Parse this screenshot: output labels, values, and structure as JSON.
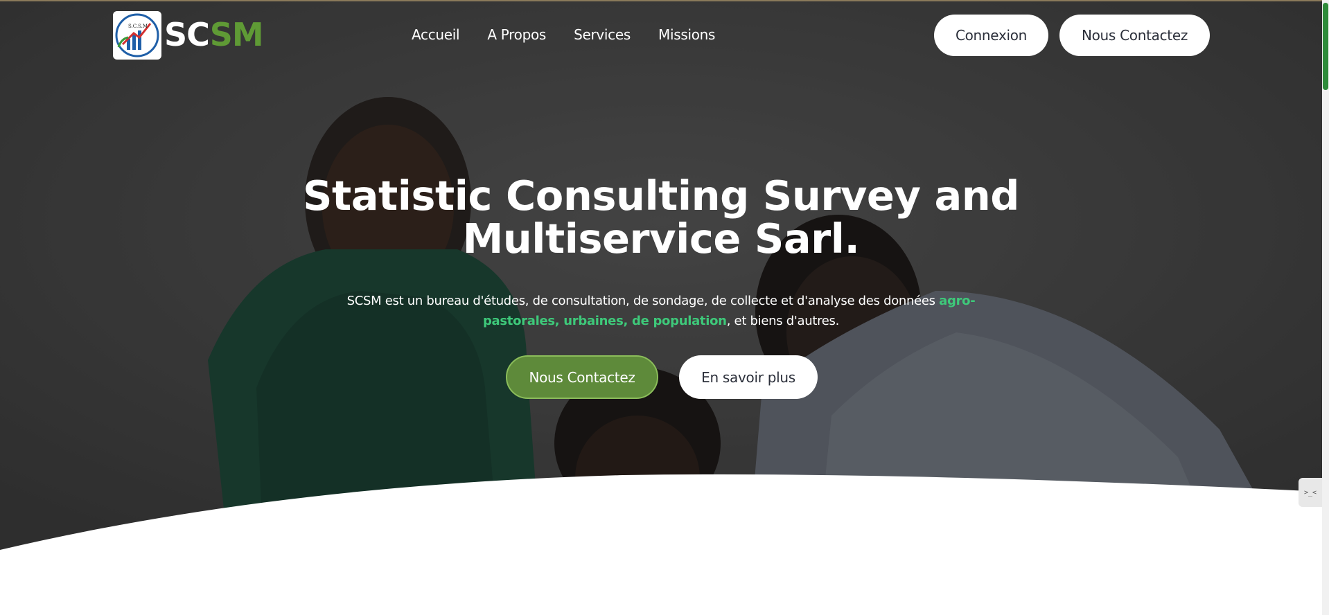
{
  "brand": {
    "logo_alt": "S.C.S.M",
    "name_part1": "SC",
    "name_part2": "SM",
    "colors": {
      "accent_green": "#5f9a35",
      "highlight_green": "#3ec97a"
    }
  },
  "nav": {
    "items": [
      {
        "label": "Accueil"
      },
      {
        "label": "A Propos"
      },
      {
        "label": "Services"
      },
      {
        "label": "Missions"
      }
    ]
  },
  "header_actions": {
    "login_label": "Connexion",
    "contact_label": "Nous Contactez"
  },
  "hero": {
    "title_line1": "Statistic Consulting Survey and",
    "title_line2": "Multiservice Sarl.",
    "subtitle_before": "SCSM est un bureau d'études, de consultation, de sondage, de collecte et d'analyse des données ",
    "subtitle_highlight": "agro-pastorales, urbaines, de population",
    "subtitle_after": ", et biens d'autres.",
    "cta_primary": "Nous Contactez",
    "cta_secondary": "En savoir plus"
  },
  "side_widget": {
    "icon": "terminal-icon",
    "label": ">_<"
  }
}
